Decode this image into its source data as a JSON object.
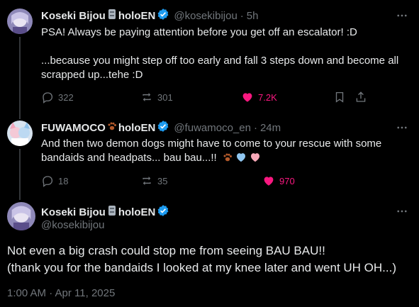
{
  "posts": [
    {
      "name": "Koseki Bijou",
      "suffix": "holoEN",
      "handle": "@kosekibijou",
      "time": "5h",
      "text_1": "PSA! Always be paying attention before you get off an escalator! :D",
      "text_2": "...because you might step off too early and fall 3 steps down and become all scrapped up...tehe :D",
      "replies": "322",
      "reposts": "301",
      "likes": "7.2K",
      "liked": true
    },
    {
      "name": "FUWAMOCO",
      "suffix": "holoEN",
      "handle": "@fuwamoco_en",
      "time": "24m",
      "text": "And then two demon dogs might have to come to your rescue with some bandaids and headpats... bau bau...!!",
      "replies": "18",
      "reposts": "35",
      "likes": "970",
      "liked": true
    }
  ],
  "main_post": {
    "name": "Koseki Bijou",
    "suffix": "holoEN",
    "handle": "@kosekibijou",
    "text_1": "Not even a big crash could stop me from seeing BAU BAU!!",
    "text_2": "(thank you for the bandaids I looked at my knee later and went UH OH...)",
    "timestamp": "1:00 AM · Apr 11, 2025"
  },
  "icons": {
    "more": "more-horizontal-icon",
    "reply": "reply-icon",
    "repost": "repost-icon",
    "like": "heart-icon",
    "bookmark": "bookmark-icon",
    "share": "share-icon",
    "verified": "verified-badge-icon",
    "rock": "moai-rock-emoji-icon",
    "paw": "paw-emoji-icon"
  },
  "colors": {
    "background": "#000000",
    "text": "#e7e9ea",
    "muted": "#71767b",
    "verified": "#1d9bf0",
    "like": "#f91880",
    "thread_line": "#333639"
  }
}
